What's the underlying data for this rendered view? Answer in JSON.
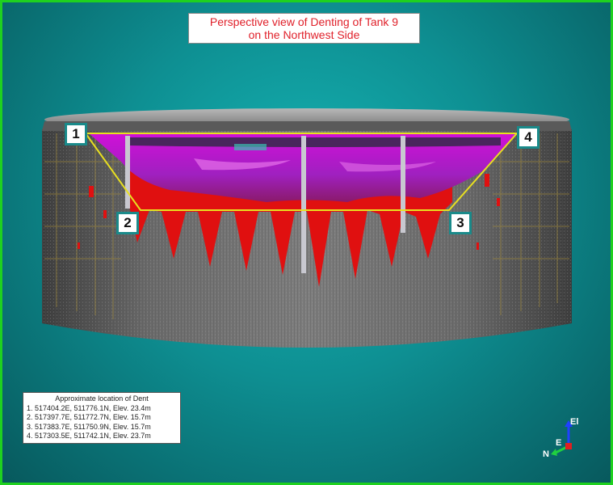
{
  "title": {
    "line1": "Perspective view of Denting of Tank 9",
    "line2": "on the Northwest Side"
  },
  "markers": [
    "1",
    "2",
    "3",
    "4"
  ],
  "legend": {
    "heading": "Approximate location of Dent",
    "items": [
      "1. 517404.2E, 511776.1N, Elev. 23.4m",
      "2. 517397.7E, 511772.7N, Elev. 15.7m",
      "3. 517383.7E, 511750.9N, Elev. 15.7m",
      "4. 517303.5E, 511742.1N, Elev. 23.7m"
    ]
  },
  "axes": {
    "up": "El",
    "north": "N",
    "east": "E"
  },
  "colors": {
    "background": "#0e8f92",
    "frame": "#1fd11f",
    "title_text": "#e0202a",
    "outline": "#e8e020",
    "dent_red": "#e01010",
    "dent_magenta": "#e020e0"
  }
}
